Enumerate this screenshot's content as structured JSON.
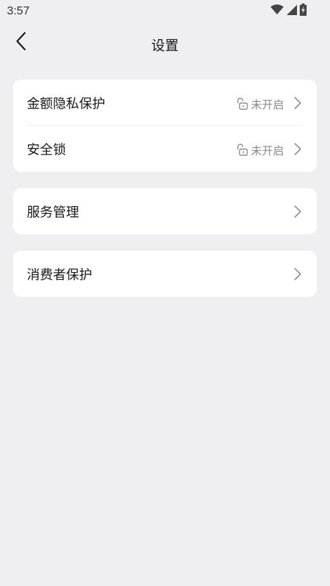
{
  "status_bar": {
    "time": "3:57",
    "icons": [
      "wifi-icon",
      "cell-signal-icon",
      "battery-charging-icon"
    ]
  },
  "nav": {
    "back_icon": "chevron-left-icon",
    "title": "设置"
  },
  "sections": [
    {
      "rows": [
        {
          "label": "金额隐私保护",
          "status": "未开启",
          "status_icon": "unlock-icon"
        },
        {
          "label": "安全锁",
          "status": "未开启",
          "status_icon": "unlock-icon"
        }
      ]
    },
    {
      "rows": [
        {
          "label": "服务管理"
        }
      ]
    },
    {
      "rows": [
        {
          "label": "消费者保护"
        }
      ]
    }
  ],
  "colors": {
    "background": "#efeff1",
    "card": "#ffffff",
    "secondary_text": "#8a8a8a"
  }
}
